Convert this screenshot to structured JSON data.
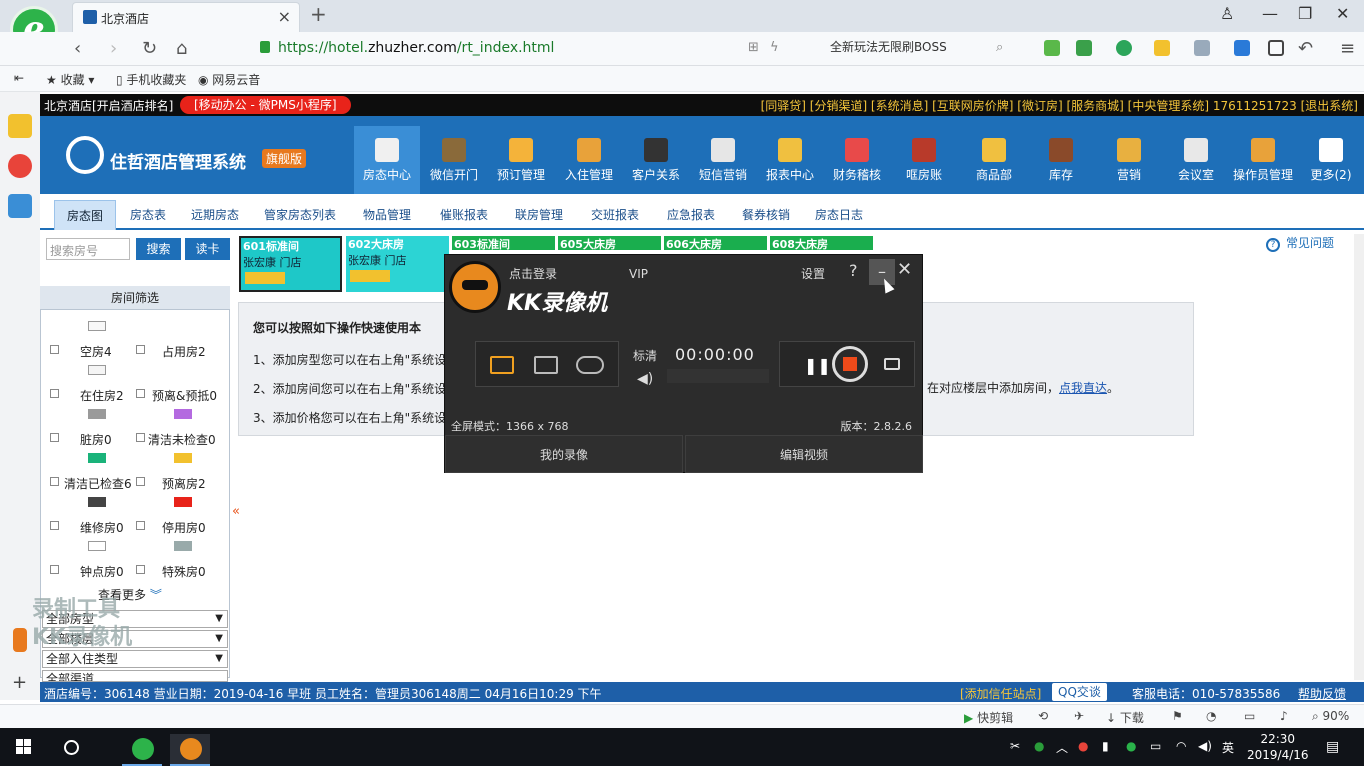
{
  "browser": {
    "tab_title": "北京酒店",
    "url_prefix": "https://hotel.",
    "url_domain": "zhuzher.com",
    "url_path": "/rt_index.html",
    "search_text": "全新玩法无限刷BOSS",
    "favorites": [
      "收藏",
      "手机收藏夹",
      "网易云音"
    ]
  },
  "topbar": {
    "left_text": "北京酒店[开启酒店排名]",
    "pill": "[移动办公 - 微PMS小程序]",
    "right_text": "[同驿贷] [分销渠道] [系统消息] [互联网房价牌] [微订房] [服务商城] [中央管理系统] 17611251723 [退出系统]"
  },
  "brand": {
    "name": "住哲酒店管理系统",
    "badge": "旗舰版"
  },
  "nav": [
    {
      "label": "房态中心",
      "color": "#f0f0f0"
    },
    {
      "label": "微信开门",
      "color": "#8a6a3a"
    },
    {
      "label": "预订管理",
      "color": "#f4b33a"
    },
    {
      "label": "入住管理",
      "color": "#e8a23a"
    },
    {
      "label": "客户关系",
      "color": "#333333"
    },
    {
      "label": "短信营销",
      "color": "#e6e6e6"
    },
    {
      "label": "报表中心",
      "color": "#f0c040"
    },
    {
      "label": "财务稽核",
      "color": "#e84a4a"
    },
    {
      "label": "哐房账",
      "color": "#b83a2a"
    },
    {
      "label": "商品部",
      "color": "#f0c040"
    },
    {
      "label": "库存",
      "color": "#8a4a2a"
    },
    {
      "label": "营销",
      "color": "#e8b040"
    },
    {
      "label": "会议室",
      "color": "#e8e8e8"
    },
    {
      "label": "操作员管理",
      "color": "#e8a23a"
    },
    {
      "label": "更多(2)",
      "color": "#ffffff"
    }
  ],
  "subnav": [
    "房态图",
    "房态表",
    "远期房态",
    "管家房态列表",
    "物品管理",
    "催账报表",
    "联房管理",
    "交班报表",
    "应急报表",
    "餐券核销",
    "房态日志"
  ],
  "left": {
    "search_placeholder": "搜索房号",
    "search_btn": "搜索",
    "read_btn": "读卡",
    "filter_title": "房间筛选",
    "filters": [
      "空房4",
      "占用房2",
      "在住房2",
      "预离&预抵0",
      "脏房0",
      "清洁未检查0",
      "清洁已检查6",
      "预离房2",
      "维修房0",
      "停用房0",
      "钟点房0",
      "特殊房0"
    ],
    "more": "查看更多",
    "selects": [
      "全部房型",
      "全部楼层",
      "全部入住类型",
      "全部渠道"
    ],
    "watermark": [
      "录制工具",
      "KK录像机"
    ]
  },
  "rooms": [
    {
      "title": "601标准间",
      "guest": "张宏康 门店"
    },
    {
      "title": "602大床房",
      "guest": "张宏康 门店"
    },
    {
      "title": "603标准间",
      "guest": ""
    },
    {
      "title": "605大床房",
      "guest": ""
    },
    {
      "title": "606大床房",
      "guest": ""
    },
    {
      "title": "608大床房",
      "guest": ""
    }
  ],
  "help": "常见问题",
  "guide": {
    "heading": "您可以按照如下操作快速使用本",
    "step1": "1、添加房型您可以在右上角\"系统设",
    "step2": "2、添加房间您可以在右上角\"系统设",
    "step3": "3、添加价格您可以在右上角\"系统设",
    "tail": "在对应楼层中添加房间，",
    "link": "点我直达",
    "tail_end": "。"
  },
  "kk": {
    "login": "点击登录",
    "vip": "VIP",
    "title": "KK录像机",
    "settings": "设置",
    "help": "?",
    "quality": "标清",
    "time": "00:00:00",
    "fullscreen": "全屏模式：1366 x 768",
    "version": "版本：2.8.2.6",
    "my_videos": "我的录像",
    "edit_video": "编辑视频"
  },
  "status": {
    "left": "酒店编号：306148  营业日期：2019-04-16   早班   员工姓名：管理员306148周二 04月16日10:29 下午",
    "add_site": "[添加信任站点]",
    "qq": "QQ交谈",
    "tel": "客服电话：010-57835586",
    "feedback": "帮助反馈"
  },
  "bottom": {
    "kuaijian": "快剪辑",
    "download": "下载",
    "zoom": "90%"
  },
  "taskbar": {
    "ime": "英",
    "time": "22:30",
    "date": "2019/4/16"
  }
}
